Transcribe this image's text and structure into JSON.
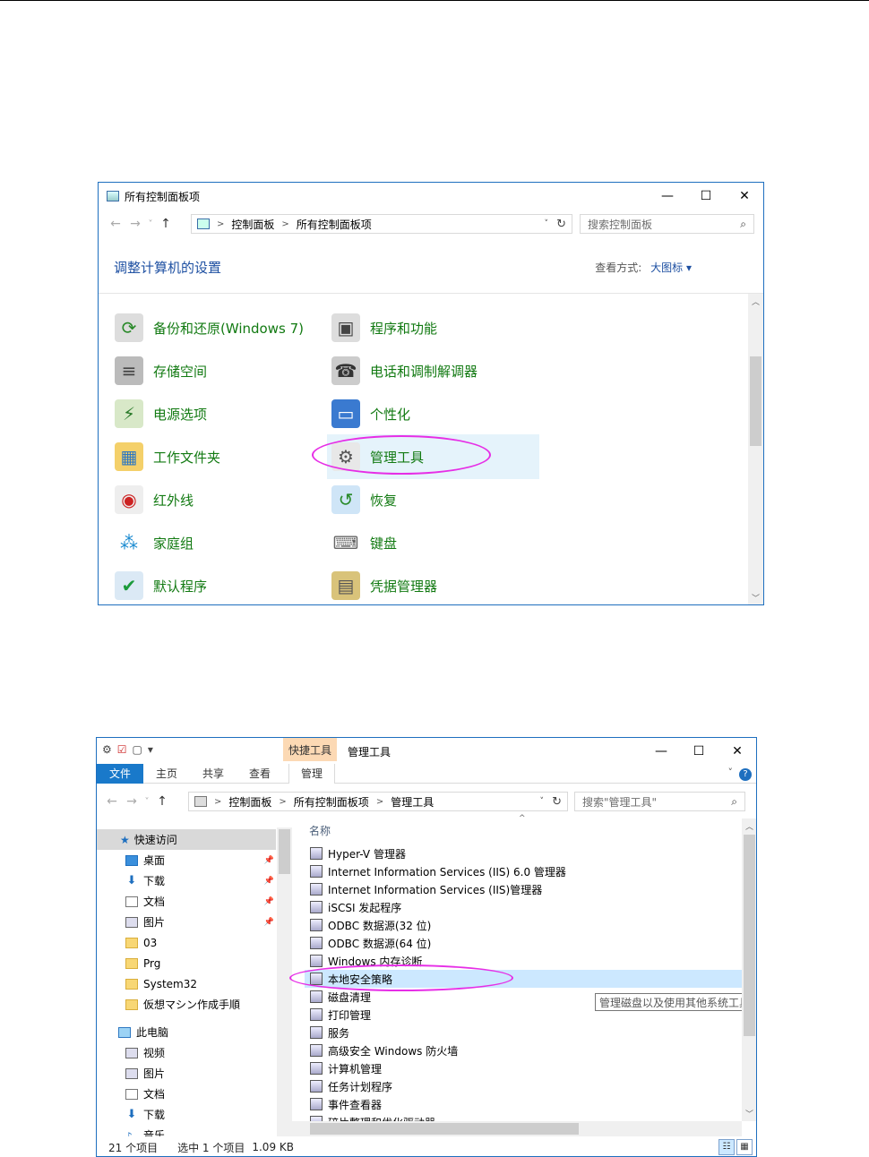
{
  "cp": {
    "title": "所有控制面板项",
    "controls": {
      "min": "—",
      "max": "☐",
      "close": "✕"
    },
    "nav": {
      "back": "←",
      "forward": "→",
      "recent": "˅",
      "up": "↑"
    },
    "breadcrumb": [
      "控制面板",
      "所有控制面板项"
    ],
    "sep": ">",
    "dropdown": "˅",
    "refresh": "↻",
    "search_placeholder": "搜索控制面板",
    "search_icon": "⌕",
    "heading": "调整计算机的设置",
    "view_label": "查看方式:",
    "view_value": "大图标 ▾",
    "items_left": [
      "备份和还原(Windows 7)",
      "存储空间",
      "电源选项",
      "工作文件夹",
      "红外线",
      "家庭组",
      "默认程序"
    ],
    "items_right": [
      "程序和功能",
      "电话和调制解调器",
      "个性化",
      "管理工具",
      "恢复",
      "键盘",
      "凭据管理器"
    ],
    "icons_left": [
      "backup-icon",
      "storage-icon",
      "power-icon",
      "work-folders-icon",
      "infrared-icon",
      "homegroup-icon",
      "default-programs-icon"
    ],
    "icons_right": [
      "programs-icon",
      "phone-modem-icon",
      "personalization-icon",
      "admin-tools-icon",
      "recovery-icon",
      "keyboard-icon",
      "credential-manager-icon"
    ],
    "selected_item": "管理工具",
    "scroll": {
      "up": "︿",
      "down": "﹀"
    }
  },
  "ex": {
    "ctx_tab": "快捷工具",
    "title": "管理工具",
    "controls": {
      "min": "—",
      "max": "☐",
      "close": "✕"
    },
    "ribbon_tabs": [
      "文件",
      "主页",
      "共享",
      "查看",
      "管理"
    ],
    "help": "?",
    "ribbon_chevron": "˅",
    "breadcrumb": [
      "控制面板",
      "所有控制面板项",
      "管理工具"
    ],
    "search_placeholder": "搜索\"管理工具\"",
    "column_name": "名称",
    "sort_caret": "^",
    "nav": [
      {
        "label": "快速访问",
        "pin": false
      },
      {
        "label": "桌面",
        "pin": true
      },
      {
        "label": "下载",
        "pin": true
      },
      {
        "label": "文档",
        "pin": true
      },
      {
        "label": "图片",
        "pin": true
      },
      {
        "label": "03",
        "pin": false
      },
      {
        "label": "Prg",
        "pin": false
      },
      {
        "label": "System32",
        "pin": false
      },
      {
        "label": "仮想マシン作成手順",
        "pin": false
      },
      {
        "label": "此电脑",
        "pin": false
      },
      {
        "label": "视频",
        "pin": false
      },
      {
        "label": "图片",
        "pin": false
      },
      {
        "label": "文档",
        "pin": false
      },
      {
        "label": "下载",
        "pin": false
      },
      {
        "label": "音乐",
        "pin": false
      }
    ],
    "pin_icon": "📌",
    "files": [
      "Hyper-V 管理器",
      "Internet Information Services (IIS) 6.0 管理器",
      "Internet Information Services (IIS)管理器",
      "iSCSI 发起程序",
      "ODBC 数据源(32 位)",
      "ODBC 数据源(64 位)",
      "Windows 内存诊断",
      "本地安全策略",
      "磁盘清理",
      "打印管理",
      "服务",
      "高级安全 Windows 防火墙",
      "计算机管理",
      "任务计划程序",
      "事件查看器",
      "碎片整理和优化驱动器"
    ],
    "selected_file": "本地安全策略",
    "tooltip": "管理磁盘以及使用其他系统工具来管",
    "status_count": "21 个项目",
    "status_sel": "选中 1 个项目",
    "status_size": "1.09 KB",
    "view_icons": [
      "☷",
      "▦"
    ]
  },
  "colors": {
    "accent": "#1e6fbf",
    "highlight_ellipse": "#e62ee6",
    "cp_link": "#127a12",
    "heading": "#1e50a2"
  }
}
